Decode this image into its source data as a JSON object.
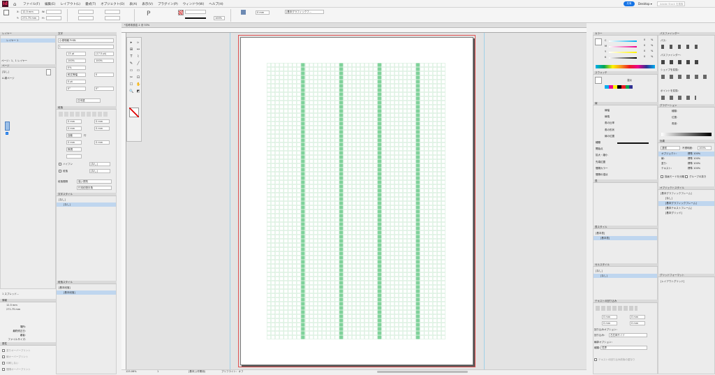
{
  "app": {
    "logo": "Id",
    "home_icon": "home-icon"
  },
  "menu": [
    "ファイル(F)",
    "編集(E)",
    "レイアウト(L)",
    "書式(T)",
    "オブジェクト(O)",
    "表(A)",
    "表示(V)",
    "プラグイン(P)",
    "ウィンドウ(W)",
    "ヘルプ(H)"
  ],
  "topright": {
    "share": "共有",
    "workspace": "Adobe Stock を検索"
  },
  "control": {
    "x": "12.5 mm",
    "y": "271.75 mm",
    "x_label": "X:",
    "y_label": "Y:",
    "w_label": "W:",
    "h_label": "H:",
    "stroke_value": "0 mm",
    "zoom_pct": "100%",
    "frame_style": "[基本グラフィックフ..."
  },
  "doc_tab": {
    "title": "*名称未設定-1 @ 53%"
  },
  "layers": {
    "title": "レイヤー",
    "layer_name": "レイヤー 1",
    "info": "ページ：1、1 レイヤー"
  },
  "pages": {
    "title": "ページ",
    "none": "[なし]",
    "master": "A-親ページ",
    "page_num": "1",
    "footer": "1 スプレッド..."
  },
  "char": {
    "title": "文字",
    "font": "小塚明朝 Pr6N",
    "style": "L",
    "size": "13 pt",
    "leading": "(17.5 pt)",
    "vscale": "100%",
    "hscale": "100%",
    "tsume": "0%",
    "kerning": "和文等幅",
    "tracking": "0",
    "baseline": "0 pt",
    "rot": "0°",
    "skew": "0°",
    "lang": "日本語"
  },
  "para": {
    "title": "段落",
    "indent_l": "0 mm",
    "indent_r": "0 mm",
    "first": "0 mm",
    "last": "0 mm",
    "auto": "自動",
    "lines": "行",
    "space_b": "0 mm",
    "space_a": "0 mm",
    "none": "[なし]",
    "hyphen": "なし",
    "kinsoku": "強い禁則",
    "mojikumi": "行末約物半角",
    "grid_none": "無視",
    "para_label": "段落間隔"
  },
  "para_styles": {
    "title": "段落スタイル",
    "items": [
      "[基本段落]"
    ],
    "sel": "[基本段落]"
  },
  "char_styles": {
    "title": "文字スタイル",
    "items": [
      "[なし]"
    ]
  },
  "info": {
    "title": "情報",
    "x": "12.5 mm",
    "y": "271.75 mm",
    "labels": [
      "場所:",
      "最終修正日:",
      "著者:",
      "ファイルサイズ:"
    ]
  },
  "print_attr": {
    "title": "属性",
    "items": [
      "塗りオーバープリント",
      "線オーバープリント",
      "印刷しない",
      "間隔オーバープリント"
    ]
  },
  "color": {
    "title": "カラー",
    "c": "C",
    "m": "M",
    "y": "Y",
    "k": "K",
    "cv": "0",
    "mv": "0",
    "yv": "0",
    "kv": "0",
    "pct": "%"
  },
  "swatches": {
    "title": "スウォッチ",
    "tint": "濃淡",
    "pct": "%"
  },
  "stroke": {
    "title": "線",
    "weight": "線幅",
    "cap": "線端",
    "miter": "角の比率",
    "join": "角の形状",
    "align": "線の位置",
    "type": "種類",
    "start": "開始点",
    "none": "なし",
    "scale": "拡大・縮小",
    "s1": "100%",
    "s2": "100%",
    "gap_color": "間隔カラー",
    "gap_none": "[なし]",
    "gap_tint": "間隔の濃淡",
    "miter_val": "4",
    "x_val": "x",
    "align_label": "先端位置"
  },
  "table": {
    "title": "表"
  },
  "cell_styles": {
    "title": "表スタイル",
    "items": [
      "[基本表]"
    ]
  },
  "obj_styles2": {
    "title": "セルスタイル",
    "items": [
      "[なし]"
    ]
  },
  "text_wrap": {
    "title": "テキストの回り込み",
    "offset": "0 mm",
    "opt": "回り込みオプション：",
    "side": "回り込み：",
    "side_val": "左右両サイド",
    "contour": "輪郭オプション：",
    "type": "種類：",
    "type_val": "境界",
    "apply": "テキストの回り込み前後の重なり"
  },
  "pathfinder": {
    "title": "パスファインダー",
    "path": "パス：",
    "pf": "パスファインダー：",
    "shape": "シェイプを変換：",
    "point": "ポイントを変換："
  },
  "gradient": {
    "title": "グラデーション",
    "type": "種類：",
    "pos": "位置：",
    "angle": "角度："
  },
  "effects": {
    "title": "効果",
    "mode": "通常",
    "opacity": "不透明度：",
    "opacity_val": "100%",
    "rows": [
      {
        "label": "オブジェクト：",
        "value": "標準 100%"
      },
      {
        "label": "線：",
        "value": "標準 100%"
      },
      {
        "label": "塗り：",
        "value": "標準 100%"
      },
      {
        "label": "テキスト：",
        "value": "標準 100%"
      }
    ],
    "isolate": "描画モードを分離",
    "knockout": "グループの抜き"
  },
  "obj_styles": {
    "title": "オブジェクトスタイル",
    "header": "[基本グラフィックフレーム]",
    "items": [
      "[なし]",
      "[基本グラフィックフレーム]",
      "[基本テキストフレーム]",
      "[基本グリッド]"
    ],
    "sel": 1
  },
  "grid_formats": {
    "title": "グリッドフォーマット",
    "items": [
      "[レイアウトグリッド]"
    ]
  },
  "status": {
    "zoom": "125.06%",
    "page": "1",
    "style": "[基本] (作業用)",
    "preflight": "プリフライト：オフ"
  },
  "colors": {
    "grid_green": "#7ed29a",
    "grid_line": "#bfe5c9",
    "margin": "#d36bbf",
    "accent": "#1473e6",
    "selection": "#bfd6ef"
  }
}
